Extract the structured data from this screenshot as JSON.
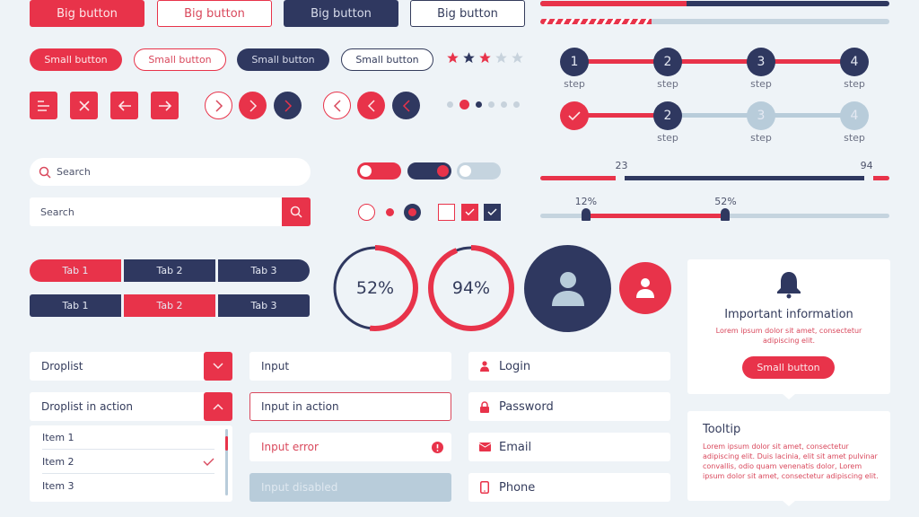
{
  "colors": {
    "primary": "#e8334a",
    "navy": "#2f3860",
    "muted": "#b8ccda",
    "background": "#eef3f7"
  },
  "big_buttons": [
    "Big button",
    "Big button",
    "Big button",
    "Big button"
  ],
  "small_buttons": [
    "Small button",
    "Small button",
    "Small button",
    "Small button"
  ],
  "rating": {
    "value": 3,
    "max": 5,
    "icon": "star-icon"
  },
  "icon_buttons": [
    "menu-icon",
    "close-icon",
    "arrow-left-icon",
    "arrow-right-icon"
  ],
  "nav_circles": [
    "chevron-right-icon",
    "chevron-right-icon",
    "chevron-right-icon",
    "chevron-left-icon",
    "chevron-left-icon",
    "chevron-left-icon"
  ],
  "pagination": {
    "count": 6,
    "active": 2
  },
  "progress": [
    {
      "value": 0.42
    },
    {
      "value": 0.32,
      "style": "striped"
    }
  ],
  "stepper1": {
    "steps": [
      {
        "num": "1",
        "label": "step"
      },
      {
        "num": "2",
        "label": "step"
      },
      {
        "num": "3",
        "label": "step"
      },
      {
        "num": "4",
        "label": "step"
      }
    ],
    "completed": 4
  },
  "stepper2": {
    "steps": [
      {
        "num": "✓",
        "label": ""
      },
      {
        "num": "2",
        "label": "step"
      },
      {
        "num": "3",
        "label": "step"
      },
      {
        "num": "4",
        "label": "step"
      }
    ],
    "current": 2
  },
  "range_slider": {
    "min_label": "23",
    "max_label": "94",
    "low": 23,
    "high": 94
  },
  "percent_slider": {
    "low_label": "12%",
    "high_label": "52%",
    "low": 12,
    "high": 52
  },
  "search1": {
    "placeholder": "Search"
  },
  "search2": {
    "placeholder": "Search"
  },
  "toggles": [
    {
      "state": "off",
      "theme": "red"
    },
    {
      "state": "on",
      "theme": "navy"
    },
    {
      "state": "off",
      "theme": "disabled"
    }
  ],
  "radios": [
    "unchecked",
    "small-dot",
    "checked"
  ],
  "checkboxes": [
    "unchecked",
    "checked-red",
    "checked-navy"
  ],
  "tabs1": {
    "labels": [
      "Tab 1",
      "Tab 2",
      "Tab 3"
    ],
    "active": 0
  },
  "tabs2": {
    "labels": [
      "Tab 1",
      "Tab 2",
      "Tab 3"
    ],
    "active": 1
  },
  "donuts": [
    {
      "label": "52%",
      "value": 52
    },
    {
      "label": "94%",
      "value": 94
    }
  ],
  "avatars": [
    "user-icon",
    "user-icon"
  ],
  "droplist": {
    "label": "Droplist"
  },
  "droplist_active": {
    "label": "Droplist in action",
    "items": [
      "Item 1",
      "Item 2",
      "Item 3"
    ],
    "selected": "Item 2"
  },
  "inputs": {
    "normal": "Input",
    "active": "Input in action",
    "error": "Input error",
    "disabled": "Input disabled"
  },
  "icon_inputs": [
    {
      "icon": "user-icon",
      "label": "Login"
    },
    {
      "icon": "lock-icon",
      "label": "Password"
    },
    {
      "icon": "mail-icon",
      "label": "Email"
    },
    {
      "icon": "phone-icon",
      "label": "Phone"
    }
  ],
  "notification": {
    "title": "Important information",
    "text": "Lorem ipsum dolor sit amet, consectetur adipiscing elit.",
    "button": "Small button"
  },
  "tooltip": {
    "title": "Tooltip",
    "text": "Lorem ipsum dolor sit amet, consectetur adipiscing elit. Duis lacinia, elit sit amet pulvinar convallis, odio quam venenatis dolor, Lorem ipsum dolor sit amet, consectetur adipiscing elit."
  }
}
